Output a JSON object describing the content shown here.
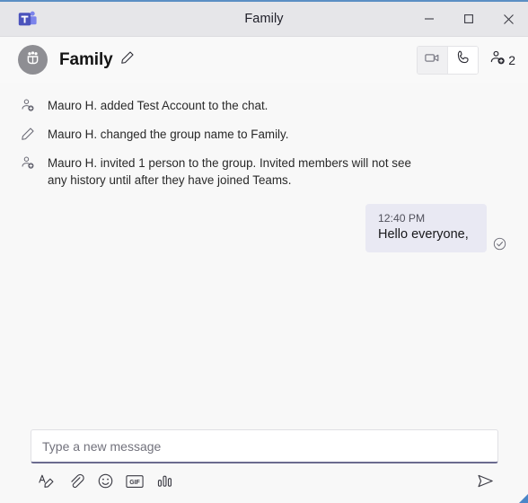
{
  "window": {
    "title": "Family",
    "app_icon": "teams-logo-icon",
    "controls": {
      "minimize": "minimize-icon",
      "maximize": "maximize-icon",
      "close": "close-icon"
    },
    "accent_color": "#5b8fc4",
    "titlebar_bg": "#e6e6e9"
  },
  "chat_header": {
    "avatar_icon": "group-people-icon",
    "title": "Family",
    "edit_icon": "pencil-icon",
    "actions": {
      "video_call": {
        "icon": "video-camera-icon",
        "enabled": false
      },
      "audio_call": {
        "icon": "phone-icon",
        "enabled": true
      },
      "add_people": {
        "icon": "person-add-icon",
        "count": "2"
      }
    }
  },
  "messages": {
    "system": [
      {
        "icon": "person-add-icon",
        "text": "Mauro H. added Test Account to the chat."
      },
      {
        "icon": "pencil-icon",
        "text": "Mauro H. changed the group name to Family."
      },
      {
        "icon": "person-add-icon",
        "text": "Mauro H. invited 1 person to the group. Invited members will not see any history until after they have joined Teams."
      }
    ],
    "outgoing": [
      {
        "time": "12:40 PM",
        "text": "Hello everyone,",
        "status_icon": "sent-check-icon",
        "bubble_color": "#e9e9f3"
      }
    ]
  },
  "composer": {
    "input_value": "",
    "placeholder": "Type a new message",
    "tools": [
      {
        "name": "format-text-icon",
        "label": "Format"
      },
      {
        "name": "attach-file-icon",
        "label": "Attach"
      },
      {
        "name": "emoji-icon",
        "label": "Emoji"
      },
      {
        "name": "gif-icon",
        "label": "GIF"
      },
      {
        "name": "poll-icon",
        "label": "Poll"
      }
    ],
    "send": {
      "icon": "send-arrow-icon",
      "label": "Send"
    }
  }
}
